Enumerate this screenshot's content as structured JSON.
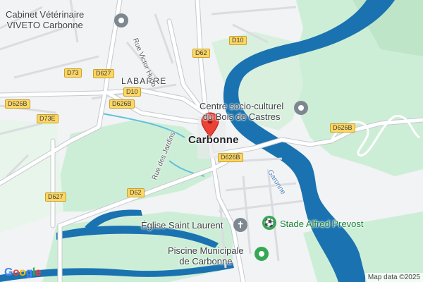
{
  "map": {
    "town": "Carbonne",
    "district": "LABARRE",
    "pois": {
      "vet_line1": "Cabinet Vétérinaire",
      "vet_line2": "VIVETO Carbonne",
      "centre_line1": "Centre socio-culturel",
      "centre_line2": "du Bois de Castres",
      "church": "Église Saint Laurent",
      "stadium": "Stade Alfred Prevost",
      "pool_line1": "Piscine Municipale",
      "pool_line2": "de Carbonne"
    },
    "streets": {
      "victor_hugo": "Rue Victor Hugo",
      "jardins": "Rue des Jardins"
    },
    "river": "Garonne",
    "roads": [
      "D10",
      "D62",
      "D73",
      "D627",
      "D10",
      "D626B",
      "D73E",
      "D626B",
      "D626B",
      "D626B",
      "D627",
      "D62"
    ],
    "colors": {
      "land": "#f1f3f4",
      "water": "#1a73b0",
      "park": "#cdeed6",
      "road": "#ffffff",
      "shield": "#fdd663",
      "pin": "#ea4335"
    },
    "icons": [
      "map-pin-icon",
      "church-icon",
      "stadium-icon",
      "pool-icon",
      "vet-icon",
      "community-centre-icon"
    ]
  },
  "footer": {
    "logo": "Google",
    "attribution": "Map data ©2025"
  }
}
